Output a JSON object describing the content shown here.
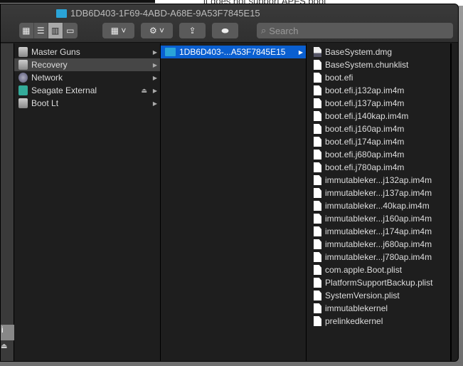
{
  "background_text": "it does not support APFS boot",
  "window": {
    "title": "1DB6D403-1F69-4ABD-A68E-9A53F7845E15"
  },
  "toolbar": {
    "search_placeholder": "Search"
  },
  "sidebar": {
    "partial_label": "i"
  },
  "column1": [
    {
      "label": "Master Guns",
      "icon": "disk-icon"
    },
    {
      "label": "Recovery",
      "icon": "disk-icon",
      "selected": true
    },
    {
      "label": "Network",
      "icon": "network-icon"
    },
    {
      "label": "Seagate External",
      "icon": "external-disk-icon",
      "eject": true
    },
    {
      "label": "Boot Lt",
      "icon": "disk-icon"
    }
  ],
  "column2": [
    {
      "label": "1DB6D403-...A53F7845E15",
      "icon": "folder-icon",
      "active": true
    }
  ],
  "column3": [
    "BaseSystem.dmg",
    "BaseSystem.chunklist",
    "boot.efi",
    "boot.efi.j132ap.im4m",
    "boot.efi.j137ap.im4m",
    "boot.efi.j140kap.im4m",
    "boot.efi.j160ap.im4m",
    "boot.efi.j174ap.im4m",
    "boot.efi.j680ap.im4m",
    "boot.efi.j780ap.im4m",
    "immutableker...j132ap.im4m",
    "immutableker...j137ap.im4m",
    "immutableker...40kap.im4m",
    "immutableker...j160ap.im4m",
    "immutableker...j174ap.im4m",
    "immutableker...j680ap.im4m",
    "immutableker...j780ap.im4m",
    "com.apple.Boot.plist",
    "PlatformSupportBackup.plist",
    "SystemVersion.plist",
    "immutablekernel",
    "prelinkedkernel"
  ]
}
